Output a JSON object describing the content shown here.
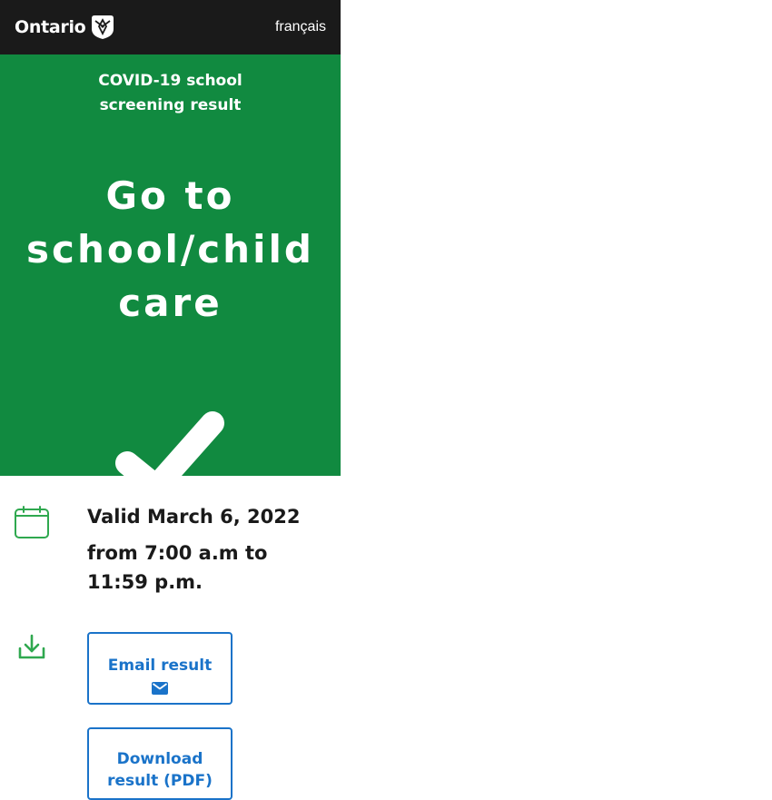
{
  "header": {
    "logo_text": "Ontario",
    "language_link": "français"
  },
  "result": {
    "subtitle_line1": "COVID-19 school",
    "subtitle_line2": "screening result",
    "headline_line1": "Go to",
    "headline_line2": "school/child",
    "headline_line3": "care",
    "status_icon": "checkmark-icon",
    "background_color": "#118a40"
  },
  "validity": {
    "icon": "calendar-icon",
    "date_text": "Valid March 6, 2022",
    "time_text": "from 7:00 a.m to 11:59 p.m."
  },
  "actions": {
    "icon": "download-icon",
    "email_label": "Email result",
    "email_icon": "envelope-icon",
    "download_label": "Download",
    "download_label_cut": "result (PDF)"
  },
  "colors": {
    "header_bg": "#1a1a1a",
    "success_green": "#118a40",
    "link_blue": "#1a73c9",
    "icon_green": "#2fa84f"
  }
}
